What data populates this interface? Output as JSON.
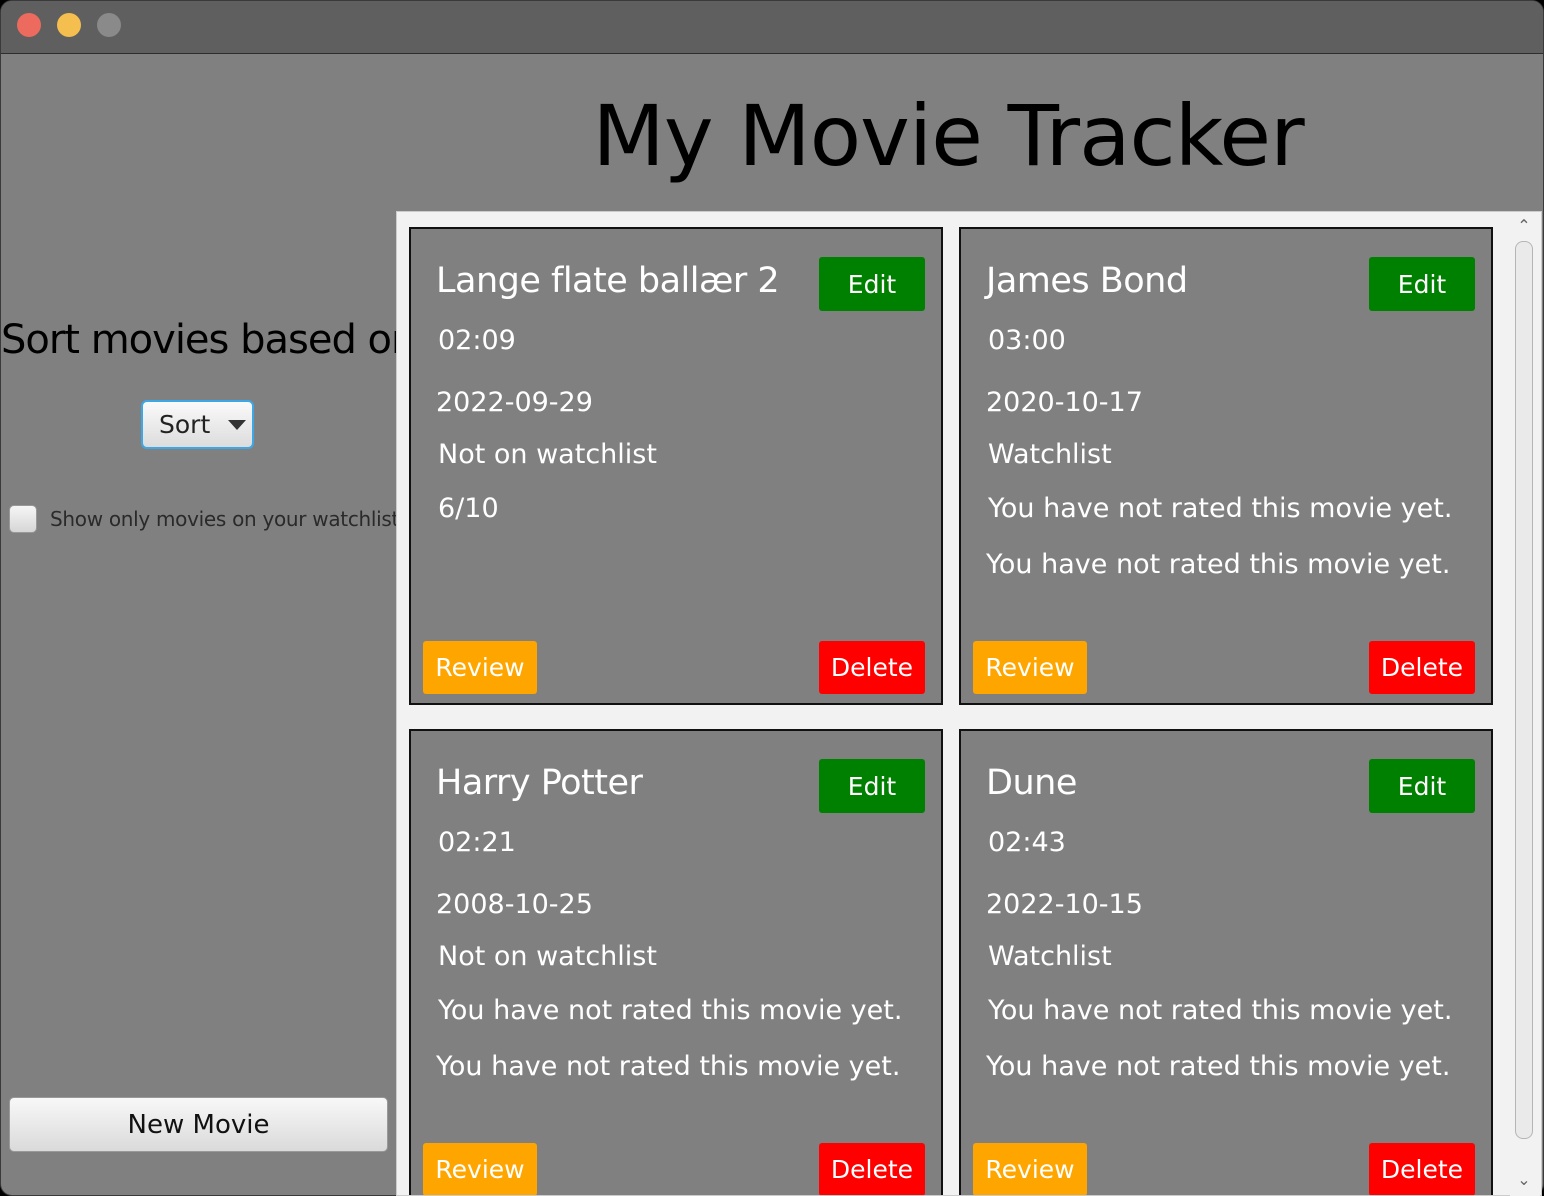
{
  "app": {
    "title": "My Movie Tracker"
  },
  "sidebar": {
    "sort_heading": "Sort movies based on:",
    "sort_button": "Sort",
    "watchlist_filter": "Show only movies on your watchlist",
    "new_movie_button": "New Movie"
  },
  "movies": [
    {
      "title": "Lange flate ballær 2",
      "duration": "02:09",
      "date": "2022-09-29",
      "watchlist": "Not on watchlist",
      "rating": "6/10",
      "review": "",
      "edit": "Edit",
      "review_btn": "Review",
      "delete": "Delete"
    },
    {
      "title": "James Bond",
      "duration": "03:00",
      "date": "2020-10-17",
      "watchlist": "Watchlist",
      "rating": "You have not rated this movie yet.",
      "review": "You have not rated this movie yet.",
      "edit": "Edit",
      "review_btn": "Review",
      "delete": "Delete"
    },
    {
      "title": "Harry Potter",
      "duration": "02:21",
      "date": "2008-10-25",
      "watchlist": "Not on watchlist",
      "rating": "You have not rated this movie yet.",
      "review": "You have not rated this movie yet.",
      "edit": "Edit",
      "review_btn": "Review",
      "delete": "Delete"
    },
    {
      "title": "Dune",
      "duration": "02:43",
      "date": "2022-10-15",
      "watchlist": "Watchlist",
      "rating": "You have not rated this movie yet.",
      "review": "You have not rated this movie yet.",
      "edit": "Edit",
      "review_btn": "Review",
      "delete": "Delete"
    }
  ],
  "colors": {
    "edit": "#008000",
    "review": "#ffa500",
    "delete": "#ff0000",
    "background": "#808080"
  },
  "icons": {
    "sort_caret": "chevron-down-icon",
    "scroll_up": "chevron-up-icon",
    "scroll_down": "chevron-down-icon"
  }
}
